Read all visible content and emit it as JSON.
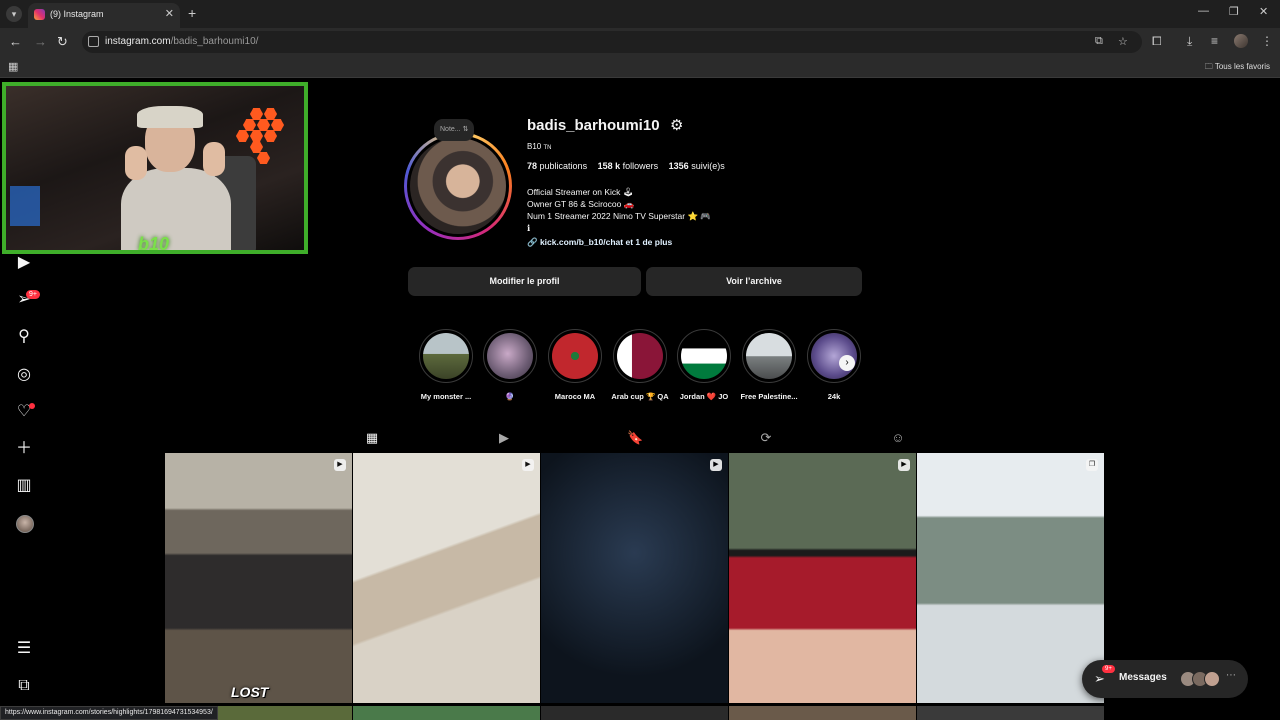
{
  "browser": {
    "tab_title": "(9) Instagram",
    "url_domain": "instagram.com",
    "url_path": "/badis_barhoumi10/",
    "bookmarks_folder": "Tous les favoris",
    "status_url": "https://www.instagram.com/stories/highlights/17981694731534953/"
  },
  "sidebar": {
    "notifications_badge": "9+"
  },
  "webcam": {
    "overlay_logo": "b10"
  },
  "profile": {
    "note_label": "Note...",
    "username": "badis_barhoumi10",
    "full_name": "B10",
    "full_name_flag": "TN",
    "posts_count": "78",
    "posts_label": "publications",
    "followers_count": "158 k",
    "followers_label": "followers",
    "following_count": "1356",
    "following_label": "suivi(e)s",
    "bio": [
      "Official Streamer on Kick 🕹",
      "Owner GT 86 & Scirocoo 🚗",
      "Num 1 Streamer 2022 Nimo TV Superstar ⭐ 🎮",
      "ℹ"
    ],
    "link": "kick.com/b_b10/chat et 1 de plus",
    "edit_button": "Modifier le profil",
    "archive_button": "Voir l’archive"
  },
  "highlights": [
    {
      "label": "My monster ..."
    },
    {
      "label": "🔮"
    },
    {
      "label": "Maroco MA"
    },
    {
      "label": "Arab cup 🏆 QA"
    },
    {
      "label": "Jordan ❤️ JO"
    },
    {
      "label": "Free Palestine..."
    },
    {
      "label": "24k"
    }
  ],
  "posts": [
    {
      "caption": "LOST"
    }
  ],
  "messages": {
    "label": "Messages",
    "badge": "9+"
  },
  "colors": {
    "background": "#000000",
    "button_bg": "#262626",
    "badge_red": "#ff3040",
    "webcam_border": "#3fae2a"
  }
}
